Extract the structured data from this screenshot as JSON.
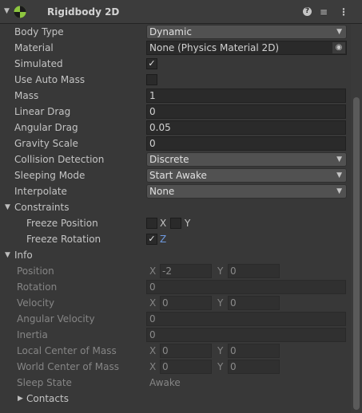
{
  "header": {
    "title": "Rigidbody 2D",
    "icons": [
      "rigidbody-icon",
      "help-icon",
      "presets-icon",
      "more-icon"
    ]
  },
  "labels": {
    "body_type": "Body Type",
    "material": "Material",
    "simulated": "Simulated",
    "use_auto_mass": "Use Auto Mass",
    "mass": "Mass",
    "linear_drag": "Linear Drag",
    "angular_drag": "Angular Drag",
    "gravity_scale": "Gravity Scale",
    "collision_detection": "Collision Detection",
    "sleeping_mode": "Sleeping Mode",
    "interpolate": "Interpolate",
    "constraints": "Constraints",
    "freeze_position": "Freeze Position",
    "freeze_rotation": "Freeze Rotation",
    "info": "Info",
    "position": "Position",
    "rotation": "Rotation",
    "velocity": "Velocity",
    "angular_velocity": "Angular Velocity",
    "inertia": "Inertia",
    "local_center_of_mass": "Local Center of Mass",
    "world_center_of_mass": "World Center of Mass",
    "sleep_state": "Sleep State",
    "contacts": "Contacts"
  },
  "values": {
    "body_type": "Dynamic",
    "material": "None (Physics Material 2D)",
    "simulated": true,
    "use_auto_mass": false,
    "mass": "1",
    "linear_drag": "0",
    "angular_drag": "0.05",
    "gravity_scale": "0",
    "collision_detection": "Discrete",
    "sleeping_mode": "Start Awake",
    "interpolate": "None"
  },
  "constraints": {
    "freeze_position_x": false,
    "freeze_position_y": false,
    "freeze_rotation_z": true,
    "axis_x": "X",
    "axis_y": "Y",
    "axis_z": "Z"
  },
  "info": {
    "axis_x": "X",
    "axis_y": "Y",
    "position_x": "-2",
    "position_y": "0",
    "rotation": "0",
    "velocity_x": "0",
    "velocity_y": "0",
    "angular_velocity": "0",
    "inertia": "0",
    "local_com_x": "0",
    "local_com_y": "0",
    "world_com_x": "0",
    "world_com_y": "0",
    "sleep_state": "Awake"
  },
  "colors": {
    "background": "#383838",
    "field": "#2a2a2a",
    "dropdown": "#515151",
    "accent_blue": "#6f9ae0",
    "rigidbody_icon_green": "#8dc63f"
  }
}
